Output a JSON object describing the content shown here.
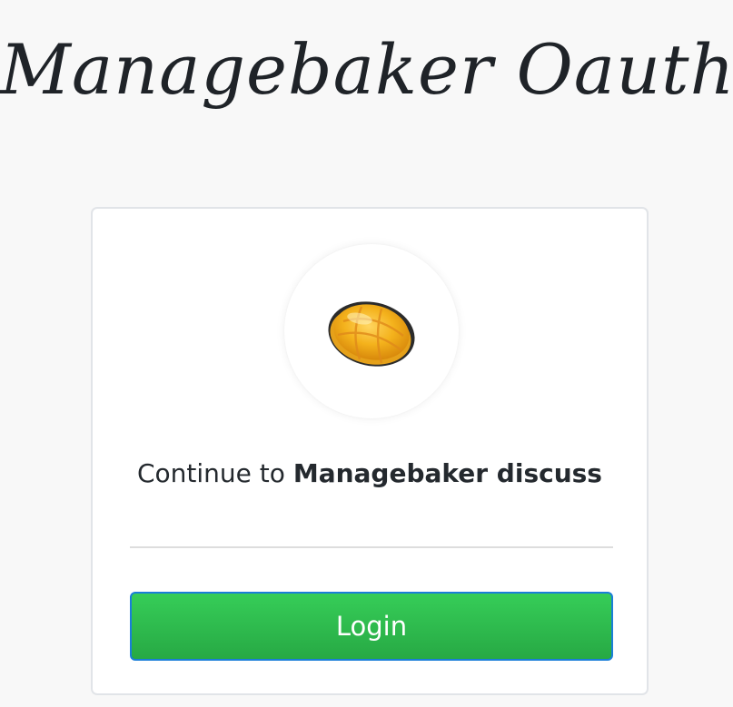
{
  "header": {
    "title": "Managebaker Oauth"
  },
  "card": {
    "logo_icon": "golden-bread-bun-icon",
    "continue_prefix": "Continue to ",
    "app_name": "Managebaker discuss",
    "login_label": "Login"
  },
  "colors": {
    "page_background": "#f8f8f8",
    "card_background": "#ffffff",
    "button_green": "#2ebd4e",
    "button_border": "#1a7ed8",
    "text": "#24292e"
  }
}
